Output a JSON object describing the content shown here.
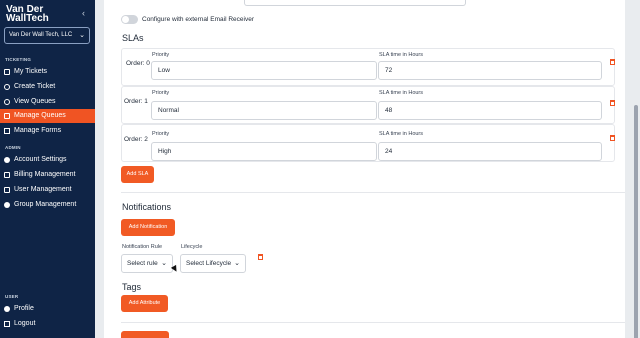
{
  "brand": {
    "line1": "Van Der",
    "line2": "WallTech"
  },
  "sidebar": {
    "org": "Van Der Wall Tech, LLC",
    "sections": {
      "ticketing": "TICKETING",
      "admin": "ADMIN",
      "user": "USER"
    },
    "items": [
      {
        "label": "My Tickets",
        "icon": "grid-icon"
      },
      {
        "label": "Create Ticket",
        "icon": "plus-circle-icon"
      },
      {
        "label": "View Queues",
        "icon": "eye-icon"
      },
      {
        "label": "Manage Queues",
        "icon": "queue-icon",
        "active": true
      },
      {
        "label": "Manage Forms",
        "icon": "form-icon"
      },
      {
        "label": "Account Settings",
        "icon": "user-circle-icon"
      },
      {
        "label": "Billing Management",
        "icon": "card-icon"
      },
      {
        "label": "User Management",
        "icon": "users-icon"
      },
      {
        "label": "Group Management",
        "icon": "group-icon"
      },
      {
        "label": "Profile",
        "icon": "person-icon"
      },
      {
        "label": "Logout",
        "icon": "logout-icon"
      }
    ]
  },
  "main": {
    "toggle_label": "Configure with external Email Receiver",
    "slas_title": "SLAs",
    "priority_label": "Priority",
    "sla_time_label": "SLA time in Hours",
    "slas": [
      {
        "order": "Order: 0",
        "priority": "Low",
        "hours": "72"
      },
      {
        "order": "Order: 1",
        "priority": "Normal",
        "hours": "48"
      },
      {
        "order": "Order: 2",
        "priority": "High",
        "hours": "24"
      }
    ],
    "add_sla": "Add SLA",
    "notifications_title": "Notifications",
    "add_notification": "Add Notification",
    "notification_rule_label": "Notification Rule",
    "lifecycle_label": "Lifecycle",
    "rule_placeholder": "Select rule",
    "lifecycle_placeholder": "Select Lifecycle",
    "tags_title": "Tags",
    "add_attribute": "Add Attribute"
  },
  "colors": {
    "sidebar": "#0f2446",
    "accent": "#f15a24"
  }
}
